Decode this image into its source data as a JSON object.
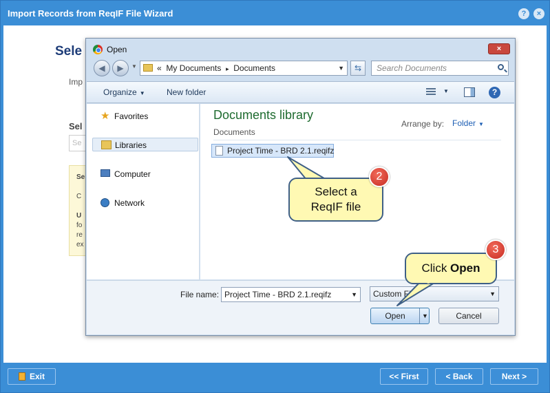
{
  "wizard": {
    "title": "Import Records from ReqIF File Wizard",
    "help_icon": "?",
    "close_icon": "×",
    "background": {
      "heading": "Sele",
      "intro": "Imp",
      "select_label": "Sel",
      "select_placeholder": "Se",
      "note_lines": [
        "Se",
        "C",
        "U",
        "fo",
        "re",
        "ex"
      ]
    },
    "footer": {
      "exit_label": "Exit",
      "first_label": "<< First",
      "back_label": "< Back",
      "next_label": "Next >"
    }
  },
  "dialog": {
    "title": "Open",
    "close_icon": "×",
    "address": {
      "prefix": "«",
      "segments": [
        "My Documents",
        "Documents"
      ],
      "separator": "▸"
    },
    "search_placeholder": "Search Documents",
    "toolbar": {
      "organize_label": "Organize",
      "new_folder_label": "New folder",
      "help_icon": "?"
    },
    "nav": {
      "favorites": "Favorites",
      "libraries": "Libraries",
      "computer": "Computer",
      "network": "Network"
    },
    "library": {
      "title": "Documents library",
      "subtitle": "Documents",
      "arrange_label": "Arrange by:",
      "arrange_value": "Folder"
    },
    "files": [
      "Project Time - BRD 2.1.reqifz"
    ],
    "file_name_label": "File name:",
    "file_name_value": "Project Time - BRD 2.1.reqifz",
    "filter_value": "Custom Fil",
    "open_label": "Open",
    "cancel_label": "Cancel"
  },
  "callouts": {
    "step2_badge": "2",
    "step2_line1": "Select a",
    "step2_line2": "ReqIF file",
    "step3_badge": "3",
    "step3_prefix": "Click ",
    "step3_bold": "Open"
  },
  "colors": {
    "wizard_blue": "#3b8ed6",
    "callout_fill": "#fff9b3",
    "badge_red": "#d93a2e",
    "library_green": "#1e6b2f"
  }
}
